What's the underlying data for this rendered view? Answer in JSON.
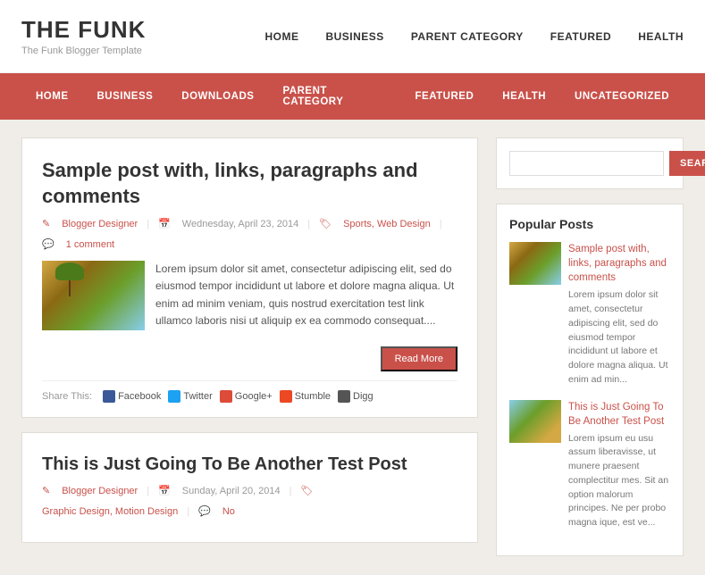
{
  "site": {
    "title": "THE FUNK",
    "subtitle": "The Funk Blogger Template"
  },
  "top_nav": {
    "items": [
      "HOME",
      "BUSINESS",
      "PARENT CATEGORY",
      "FEATURED",
      "HEALTH"
    ]
  },
  "main_nav": {
    "items": [
      "HOME",
      "BUSINESS",
      "DOWNLOADS",
      "PARENT CATEGORY",
      "FEATURED",
      "HEALTH",
      "UNCATEGORIZED"
    ]
  },
  "post1": {
    "title": "Sample post with, links, paragraphs and comments",
    "author": "Blogger Designer",
    "date": "Wednesday, April 23, 2014",
    "categories": "Sports, Web Design",
    "comments": "1 comment",
    "excerpt": "Lorem ipsum dolor sit amet, consectetur adipiscing elit, sed do eiusmod tempor incididunt ut labore et dolore magna aliqua. Ut enim ad minim veniam, quis nostrud exercitation test link ullamco laboris nisi ut aliquip ex ea commodo consequat....",
    "read_more": "Read More"
  },
  "share": {
    "label": "Share This:",
    "items": [
      "Facebook",
      "Twitter",
      "Google+",
      "Stumble",
      "Digg"
    ]
  },
  "post2": {
    "title": "This is Just Going To Be Another Test Post",
    "author": "Blogger Designer",
    "date": "Sunday, April 20, 2014",
    "categories": "Graphic Design, Motion Design",
    "comments": "No"
  },
  "search": {
    "placeholder": "",
    "button": "SEARCH"
  },
  "sidebar": {
    "popular_title": "Popular Posts",
    "popular_items": [
      {
        "title": "Sample post with, links, paragraphs and comments",
        "excerpt": "Lorem ipsum dolor sit amet, consectetur adipiscing elit, sed do eiusmod tempor incididunt ut labore et dolore magna aliqua. Ut enim ad min..."
      },
      {
        "title": "This is Just Going To Be Another Test Post",
        "excerpt": "Lorem ipsum eu usu assum liberavisse, ut munere praesent complectitur mes. Sit an option malorum principes. Ne per probo magna ique, est ve..."
      }
    ]
  }
}
